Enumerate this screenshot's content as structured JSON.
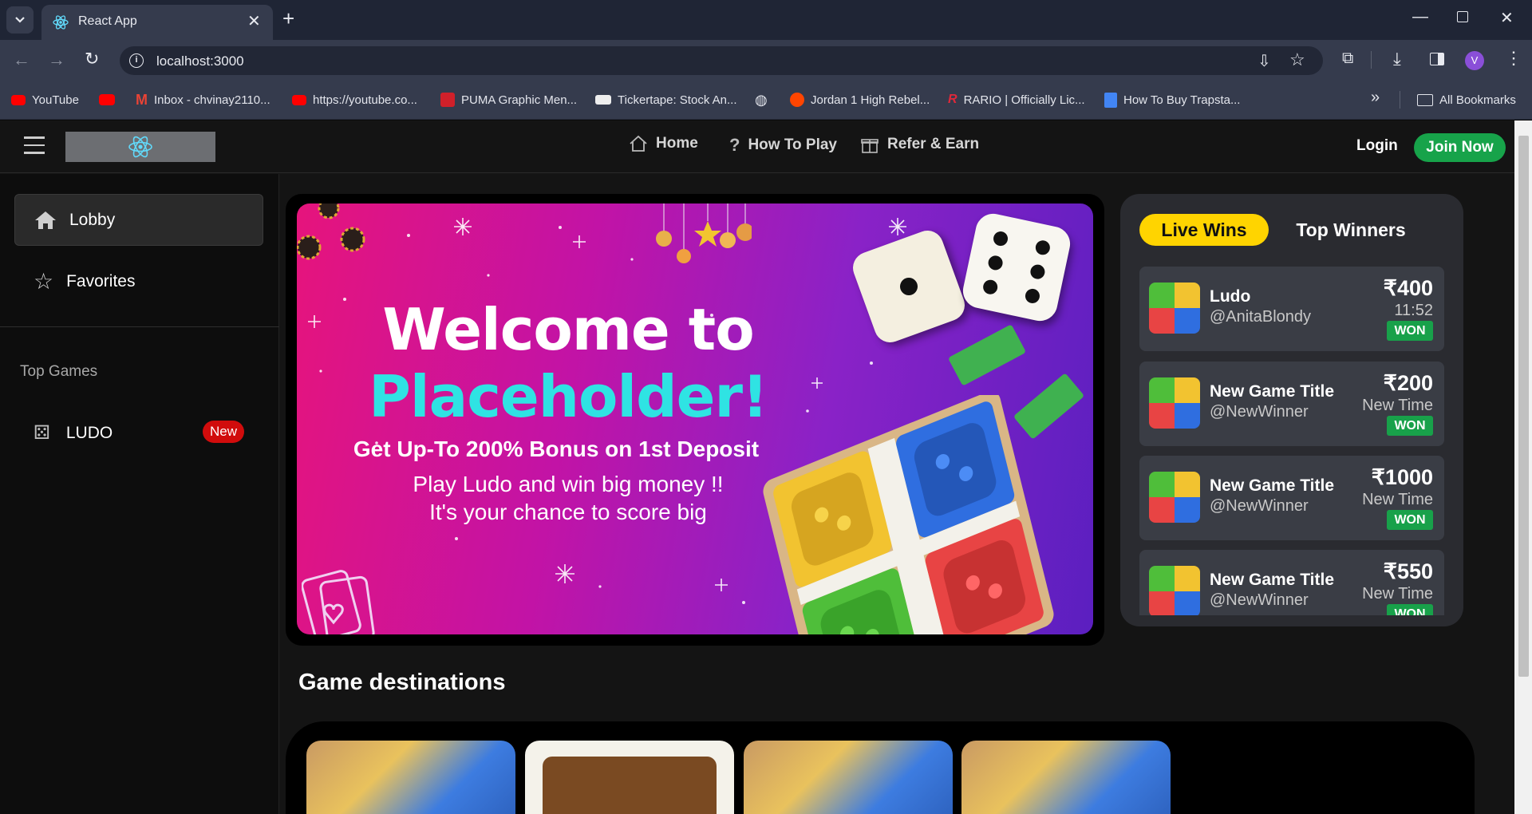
{
  "browser": {
    "tab_title": "React App",
    "url": "localhost:3000",
    "bookmarks": [
      "YouTube",
      "",
      "Inbox - chvinay2110...",
      "https://youtube.co...",
      "PUMA Graphic Men...",
      "Tickertape: Stock An...",
      "",
      "Jordan 1 High Rebel...",
      "RARIO | Officially Lic...",
      "How To Buy Trapsta..."
    ],
    "all_bookmarks": "All Bookmarks",
    "profile_initial": "V"
  },
  "header": {
    "nav": [
      "Home",
      "How To Play",
      "Refer & Earn"
    ],
    "login": "Login",
    "join": "Join Now"
  },
  "sidebar": {
    "lobby": "Lobby",
    "favorites": "Favorites",
    "top_games_heading": "Top Games",
    "game_name": "LUDO",
    "game_badge": "New"
  },
  "banner": {
    "line1": "Welcome to",
    "line2": "Placeholder!",
    "line3": "Get Up-To 200% Bonus on 1st Deposit",
    "line4": "Play Ludo and win big money !!",
    "line5": "It's your chance to score big"
  },
  "wins": {
    "tab_live": "Live Wins",
    "tab_top": "Top Winners",
    "won_label": "WON",
    "items": [
      {
        "game": "Ludo",
        "user": "@AnitaBlondy",
        "amount": "₹400",
        "time": "11:52"
      },
      {
        "game": "New Game Title",
        "user": "@NewWinner",
        "amount": "₹200",
        "time": "New Time"
      },
      {
        "game": "New Game Title",
        "user": "@NewWinner",
        "amount": "₹1000",
        "time": "New Time"
      },
      {
        "game": "New Game Title",
        "user": "@NewWinner",
        "amount": "₹550",
        "time": "New Time"
      }
    ]
  },
  "section": {
    "game_destinations": "Game destinations"
  },
  "colors": {
    "accent_green": "#17a34a",
    "accent_yellow": "#ffd400",
    "badge_red": "#d10c0c"
  }
}
